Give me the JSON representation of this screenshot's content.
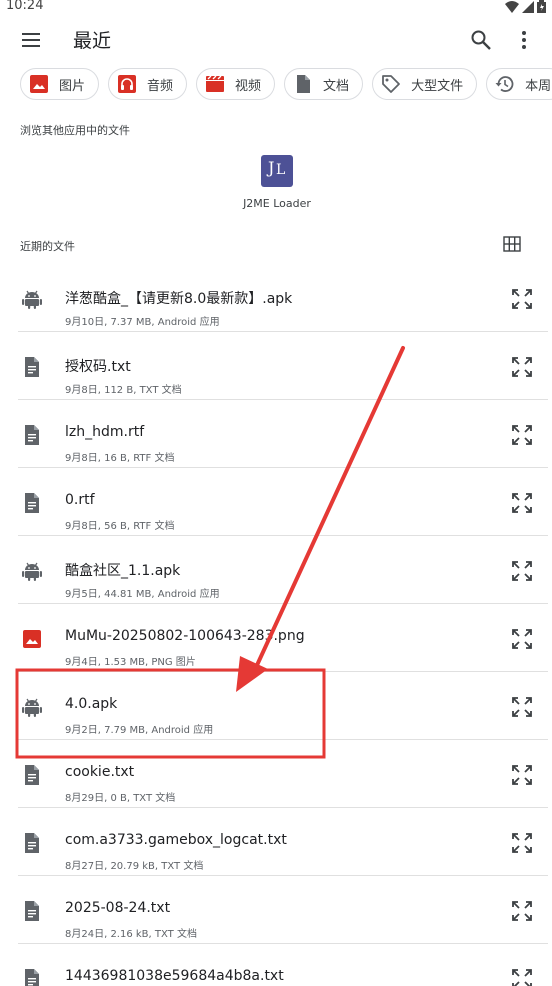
{
  "status_bar": {
    "time": "10:24",
    "icons": [
      "wifi-icon",
      "signal-icon",
      "battery-icon"
    ]
  },
  "app_bar": {
    "title": "最近",
    "menu_icon": "menu-icon",
    "search_icon": "search-icon",
    "more_icon": "more-vert-icon"
  },
  "chips": [
    {
      "label": "图片",
      "icon": "image-icon",
      "color": "#d93025"
    },
    {
      "label": "音频",
      "icon": "headphones-icon",
      "color": "#d93025"
    },
    {
      "label": "视频",
      "icon": "video-icon",
      "color": "#d93025"
    },
    {
      "label": "文档",
      "icon": "document-icon",
      "color": "#5f6368"
    },
    {
      "label": "大型文件",
      "icon": "label-icon",
      "color": "#5f6368"
    },
    {
      "label": "本周",
      "icon": "history-icon",
      "color": "#5f6368"
    }
  ],
  "other_apps": {
    "label": "浏览其他应用中的文件",
    "app": {
      "name": "J2ME Loader",
      "logo_text": "JL",
      "color": "#4d5196"
    }
  },
  "recent": {
    "label": "近期的文件",
    "view_icon": "grid-view-icon"
  },
  "files": [
    {
      "name": "洋葱酷盒_【请更新8.0最新款】.apk",
      "meta": "9月10日, 7.37 MB, Android 应用",
      "icon": "android-icon"
    },
    {
      "name": "授权码.txt",
      "meta": "9月8日, 112 B, TXT 文档",
      "icon": "document-icon"
    },
    {
      "name": "lzh_hdm.rtf",
      "meta": "9月8日, 16 B, RTF 文档",
      "icon": "document-icon"
    },
    {
      "name": "0.rtf",
      "meta": "9月8日, 56 B, RTF 文档",
      "icon": "document-icon"
    },
    {
      "name": "酷盒社区_1.1.apk",
      "meta": "9月5日, 44.81 MB, Android 应用",
      "icon": "android-icon"
    },
    {
      "name": "MuMu-20250802-100643-283.png",
      "meta": "9月4日, 1.53 MB, PNG 图片",
      "icon": "image-icon"
    },
    {
      "name": "4.0.apk",
      "meta": "9月2日, 7.79 MB, Android 应用",
      "icon": "android-icon"
    },
    {
      "name": "cookie.txt",
      "meta": "8月29日, 0 B, TXT 文档",
      "icon": "document-icon"
    },
    {
      "name": "com.a3733.gamebox_logcat.txt",
      "meta": "8月27日, 20.79 kB, TXT 文档",
      "icon": "document-icon"
    },
    {
      "name": "2025-08-24.txt",
      "meta": "8月24日, 2.16 kB, TXT 文档",
      "icon": "document-icon"
    },
    {
      "name": "14436981038e59684a4b8a.txt",
      "meta": "",
      "icon": "document-icon"
    }
  ],
  "annotation": {
    "color": "#e53935",
    "highlight_target": "4.0.apk"
  }
}
